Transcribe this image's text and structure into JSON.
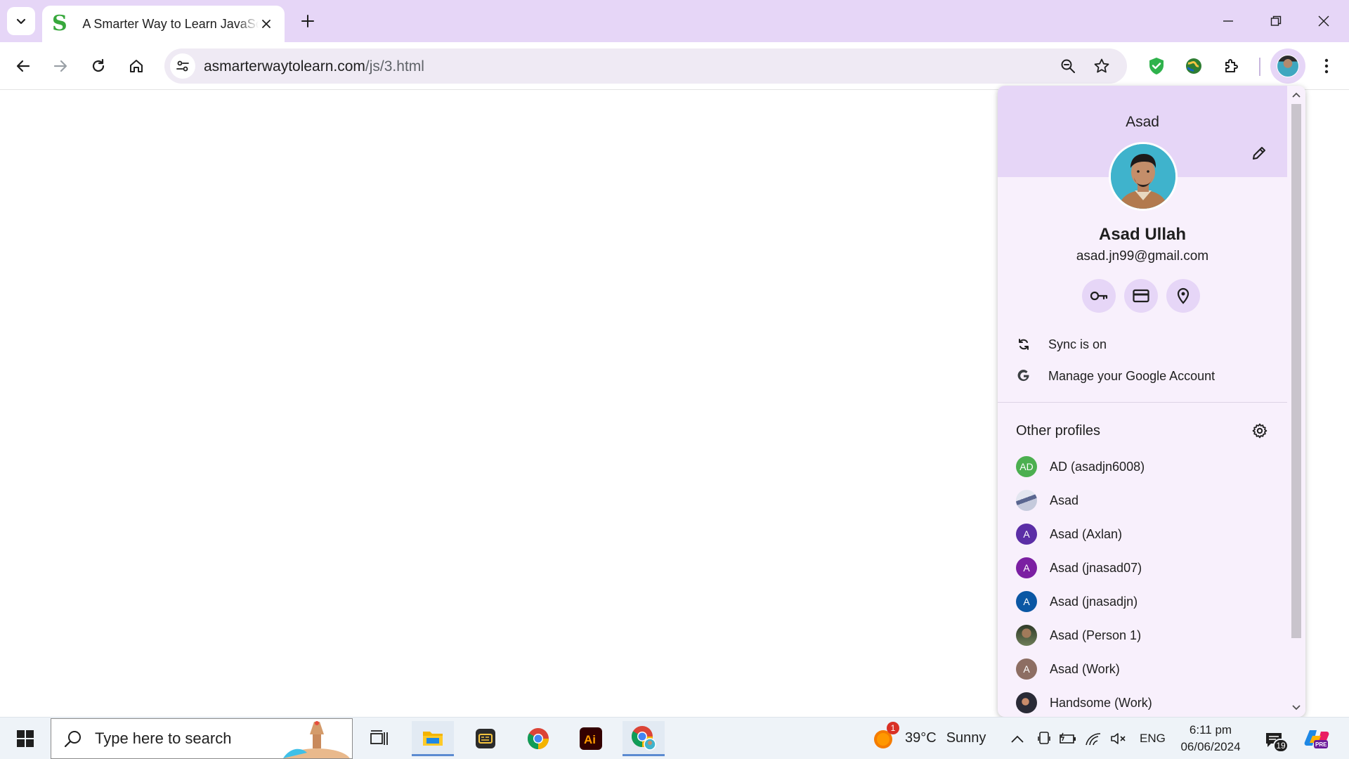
{
  "browser": {
    "tab": {
      "title": "A Smarter Way to Learn JavaScript",
      "favicon": "S"
    },
    "url": {
      "host": "asmarterwaytolearn.com",
      "path": "/js/3.html"
    }
  },
  "profile_menu": {
    "header_name": "Asad",
    "full_name": "Asad Ullah",
    "email": "asad.jn99@gmail.com",
    "sync_label": "Sync is on",
    "manage_label": "Manage your Google Account",
    "other_profiles_title": "Other profiles",
    "profiles": [
      {
        "name": "AD (asadjn6008)",
        "initials": "AD",
        "color": "#4caf50"
      },
      {
        "name": "Asad",
        "initials": "",
        "color": "#8c96b8"
      },
      {
        "name": "Asad (Axlan)",
        "initials": "A",
        "color": "#5b2ea6"
      },
      {
        "name": "Asad (jnasad07)",
        "initials": "A",
        "color": "#7b1fa2"
      },
      {
        "name": "Asad (jnasadjn)",
        "initials": "A",
        "color": "#0b57a4"
      },
      {
        "name": "Asad (Person 1)",
        "initials": "",
        "color": "#5a6b4a"
      },
      {
        "name": "Asad (Work)",
        "initials": "A",
        "color": "#8d6e63"
      },
      {
        "name": "Handsome (Work)",
        "initials": "",
        "color": "#3a3a48"
      }
    ]
  },
  "taskbar": {
    "search_placeholder": "Type here to search",
    "weather": {
      "temp": "39°C",
      "condition": "Sunny",
      "alert_count": "1"
    },
    "language": "ENG",
    "time": "6:11 pm",
    "date": "06/06/2024",
    "notification_count": "19"
  }
}
